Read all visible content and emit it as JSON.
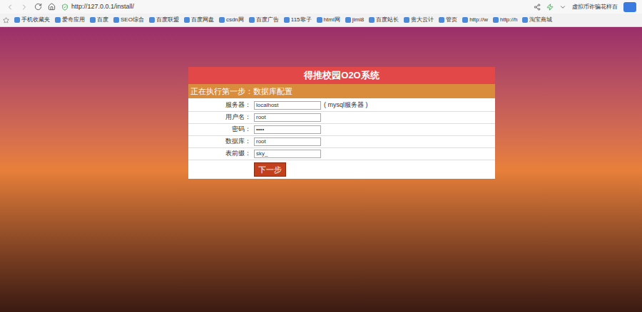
{
  "browser": {
    "url": "http://127.0.0.1/install/",
    "news_text": "虚拟币诈骗花样百"
  },
  "bookmarks": [
    {
      "label": "手机收藏夹"
    },
    {
      "label": "爱奇应用"
    },
    {
      "label": "百度"
    },
    {
      "label": "SEO综合"
    },
    {
      "label": "百度联盟"
    },
    {
      "label": "百度网盘"
    },
    {
      "label": "csdn网"
    },
    {
      "label": "百度广告"
    },
    {
      "label": "115靠子"
    },
    {
      "label": "html网"
    },
    {
      "label": "jimi8"
    },
    {
      "label": "百度站长"
    },
    {
      "label": "贵大云计"
    },
    {
      "label": "管页"
    },
    {
      "label": "http://w"
    },
    {
      "label": "http://h"
    },
    {
      "label": "淘宝商城"
    }
  ],
  "panel": {
    "title": "得推校园O2O系统",
    "step": "正在执行第一步：数据库配置",
    "fields": [
      {
        "label": "服务器：",
        "value": "localhost",
        "hint": "( mysql服务器 )"
      },
      {
        "label": "用户名：",
        "value": "root"
      },
      {
        "label": "密码：",
        "value": "••••"
      },
      {
        "label": "数据库：",
        "value": "root"
      },
      {
        "label": "表前缀：",
        "value": "sky_"
      }
    ],
    "button": "下一步"
  }
}
